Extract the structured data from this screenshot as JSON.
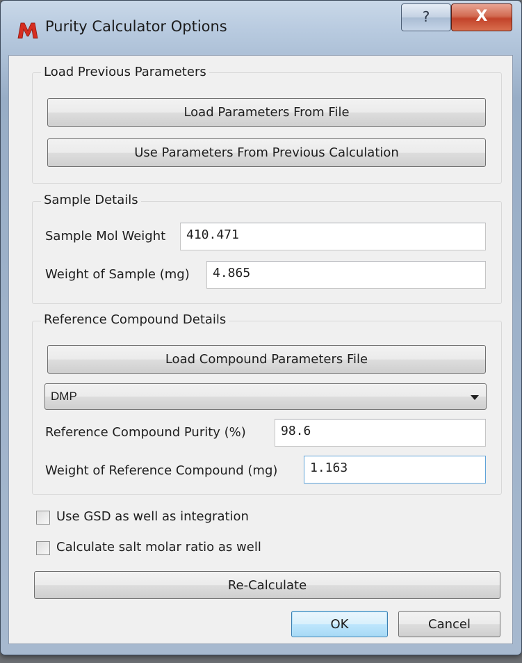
{
  "window": {
    "title": "Purity Calculator Options",
    "help_symbol": "?",
    "close_symbol": "X",
    "app_icon": "m-logo-icon"
  },
  "load_previous": {
    "title": "Load Previous Parameters",
    "load_file_button": "Load Parameters From File",
    "use_previous_button": "Use Parameters From Previous Calculation"
  },
  "sample_details": {
    "title": "Sample Details",
    "mol_weight_label": "Sample Mol Weight",
    "mol_weight_value": "410.471",
    "weight_label": "Weight of Sample (mg)",
    "weight_value": "4.865"
  },
  "reference": {
    "title": "Reference Compound Details",
    "load_compound_button": "Load Compound Parameters File",
    "compound_selected": "DMP",
    "purity_label": "Reference Compound Purity (%)",
    "purity_value": "98.6",
    "weight_label": "Weight of Reference Compound (mg)",
    "weight_value": "1.163"
  },
  "options": {
    "use_gsd_label": "Use GSD as well as integration",
    "use_gsd_checked": false,
    "salt_ratio_label": "Calculate salt molar ratio as well",
    "salt_ratio_checked": false
  },
  "actions": {
    "recalculate": "Re-Calculate",
    "ok": "OK",
    "cancel": "Cancel"
  },
  "colors": {
    "close_button": "#c2432a",
    "default_button_border": "#3c7fb1",
    "dialog_background": "#f0f0f0",
    "app_icon_red": "#d62d20"
  }
}
